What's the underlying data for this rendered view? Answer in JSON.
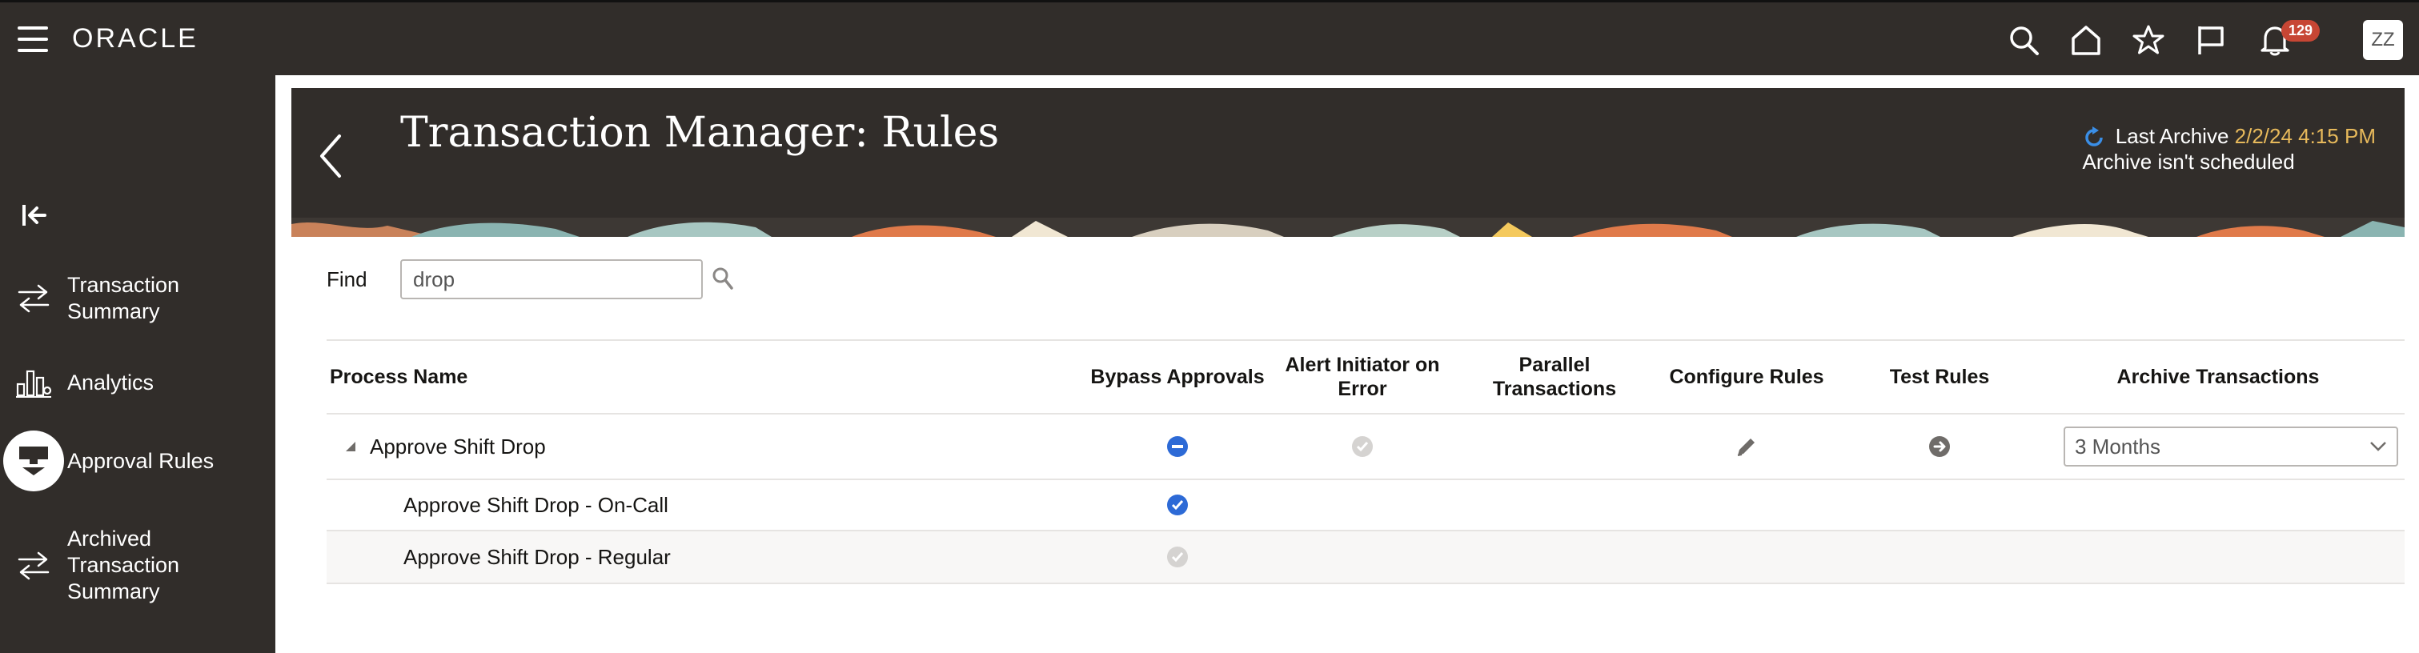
{
  "header": {
    "logo": "ORACLE",
    "notification_count": "129",
    "user_initials": "ZZ"
  },
  "sidenav": {
    "items": [
      {
        "label_line1": "Transaction",
        "label_line2": "Summary"
      },
      {
        "label_line1": "Analytics"
      },
      {
        "label_line1": "Approval Rules"
      },
      {
        "label_line1": "Archived",
        "label_line2": "Transaction",
        "label_line3": "Summary"
      }
    ]
  },
  "page": {
    "title": "Transaction Manager: Rules",
    "last_archive_label": "Last Archive",
    "last_archive_date": "2/2/24 4:15 PM",
    "archive_schedule": "Archive isn't scheduled"
  },
  "find": {
    "label": "Find",
    "value": "drop"
  },
  "table": {
    "headers": {
      "process_name": "Process Name",
      "bypass_approvals": "Bypass Approvals",
      "alert_line1": "Alert Initiator on",
      "alert_line2": "Error",
      "parallel_line1": "Parallel",
      "parallel_line2": "Transactions",
      "configure_rules": "Configure Rules",
      "test_rules": "Test Rules",
      "archive_transactions": "Archive Transactions"
    },
    "rows": [
      {
        "name": "Approve Shift Drop",
        "archive_value": "3 Months"
      },
      {
        "name": "Approve Shift Drop - On-Call"
      },
      {
        "name": "Approve Shift Drop - Regular"
      }
    ]
  },
  "colors": {
    "header_bg": "#312d2a",
    "accent_blue": "#2d6ad6",
    "badge_red": "#c74634",
    "archive_date": "#e7b95b"
  }
}
